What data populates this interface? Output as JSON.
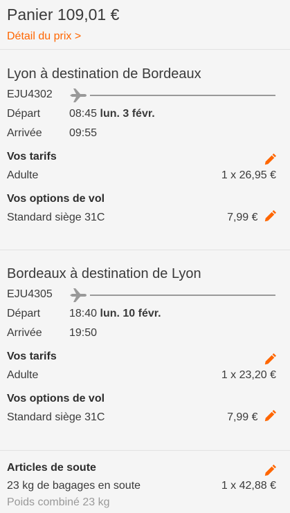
{
  "header": {
    "total": "Panier 109,01 €",
    "detail_link": "Détail du prix >"
  },
  "flights": [
    {
      "title": "Lyon à destination de Bordeaux",
      "flight_number": "EJU4302",
      "departure_label": "Départ",
      "departure_time": "08:45",
      "departure_date": "lun. 3 févr.",
      "arrival_label": "Arrivée",
      "arrival_time": "09:55",
      "fares_heading": "Vos tarifs",
      "fare_label": "Adulte",
      "fare_value": "1 x 26,95 €",
      "options_heading": "Vos options de vol",
      "option_label": "Standard siège 31C",
      "option_value": "7,99 €"
    },
    {
      "title": "Bordeaux à destination de Lyon",
      "flight_number": "EJU4305",
      "departure_label": "Départ",
      "departure_time": "18:40",
      "departure_date": "lun. 10 févr.",
      "arrival_label": "Arrivée",
      "arrival_time": "19:50",
      "fares_heading": "Vos tarifs",
      "fare_label": "Adulte",
      "fare_value": "1 x 23,20 €",
      "options_heading": "Vos options de vol",
      "option_label": "Standard siège 31C",
      "option_value": "7,99 €"
    }
  ],
  "hold_items": {
    "heading": "Articles de soute",
    "item_label": "23 kg de bagages en soute",
    "item_value": "1 x 42,88 €",
    "combined_weight": "Poids combiné 23 kg"
  },
  "colors": {
    "accent": "#ff6600",
    "text": "#3a3a3a",
    "muted": "#999999",
    "background": "#f5f5f5"
  }
}
